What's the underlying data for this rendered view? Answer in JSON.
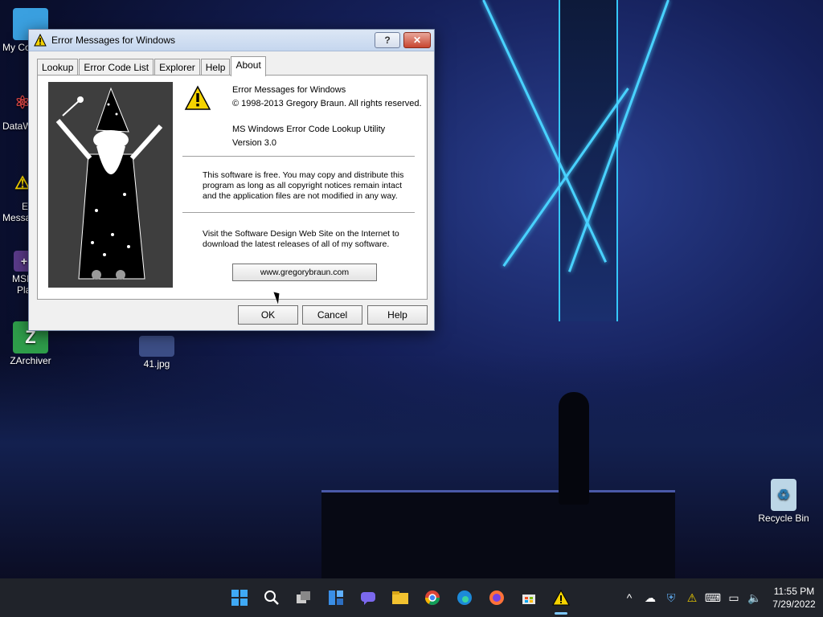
{
  "window": {
    "title": "Error Messages for Windows",
    "help_btn": "?",
    "close_btn": "✕"
  },
  "tabs": [
    {
      "label": "Lookup"
    },
    {
      "label": "Error Code List"
    },
    {
      "label": "Explorer"
    },
    {
      "label": "Help"
    },
    {
      "label": "About"
    }
  ],
  "about": {
    "app_name": "Error Messages for Windows",
    "copyright": "© 1998-2013 Gregory Braun. All rights reserved.",
    "utility_name": "MS Windows Error Code Lookup Utility",
    "version": "Version 3.0",
    "license_text": "This software is free. You may copy and distribute this program as long as all copyright notices remain intact and the application files are not modified in any way.",
    "website_text": "Visit the Software Design Web Site on the Internet to download the latest releases of all of my software.",
    "url_button": "www.gregorybraun.com"
  },
  "dialog_buttons": {
    "ok": "OK",
    "cancel": "Cancel",
    "help": "Help"
  },
  "desktop": {
    "icons": [
      {
        "label": "My Co"
      },
      {
        "label": "DataW"
      },
      {
        "label": "Er"
      },
      {
        "label": "Messa"
      },
      {
        "label": "MSI"
      },
      {
        "label": "Pla"
      },
      {
        "label": "ZArchiver"
      },
      {
        "label": "41.jpg"
      },
      {
        "label": "Recycle Bin"
      }
    ]
  },
  "taskbar": {
    "icons": [
      "windows-start-icon",
      "search-icon",
      "task-view-icon",
      "widgets-icon",
      "chat-icon",
      "file-explorer-icon",
      "chrome-icon",
      "edge-icon",
      "firefox-icon",
      "store-icon",
      "warning-app-icon"
    ],
    "time": "11:55 PM",
    "date": "7/29/2022"
  },
  "colors": {
    "warning_yellow": "#f5d300",
    "title_gradient_top": "#dce7f5",
    "close_red": "#c7452f",
    "taskbar_bg": "#20232a"
  }
}
